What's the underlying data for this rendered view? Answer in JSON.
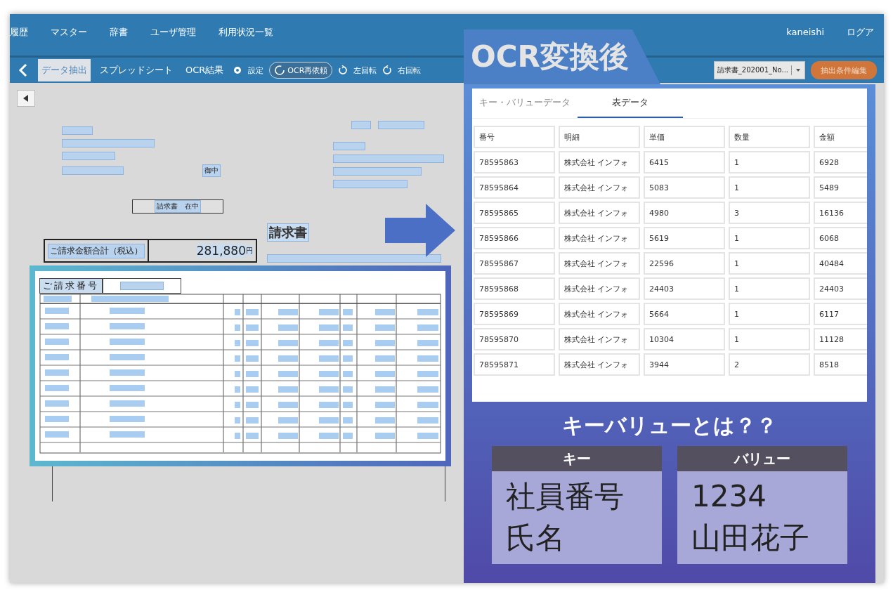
{
  "nav": {
    "items": [
      "履歴",
      "マスター",
      "辞書",
      "ユーザ管理",
      "利用状況一覧"
    ],
    "user": "kaneishi",
    "logout": "ログア"
  },
  "toolbar": {
    "tabs": [
      {
        "label": "データ抽出",
        "selected": true
      },
      {
        "label": "スプレッドシート",
        "selected": false
      },
      {
        "label": "OCR結果",
        "selected": false
      }
    ],
    "settings": "設定",
    "rerun": "OCR再依頼",
    "rotate_left": "左回転",
    "rotate_right": "右回転",
    "document_select": "請求書_202001_No...",
    "edit_button": "抽出条件編集"
  },
  "document": {
    "envelope_note": "請求書　在中",
    "addressee_suffix": "御中",
    "title": "請求書",
    "total_label": "ご請求金額合計（税込）",
    "total_amount": "281,880",
    "total_unit": "円",
    "invoice_number_label": "ご請求番号"
  },
  "ocr_panel": {
    "title": "OCR変換後",
    "tabs": [
      {
        "label": "キー・バリューデータ",
        "selected": false
      },
      {
        "label": "表データ",
        "selected": true
      }
    ],
    "columns": [
      "番号",
      "明細",
      "単価",
      "数量",
      "金額"
    ],
    "rows": [
      [
        "78595863",
        "株式会社 インフォ",
        "6415",
        "1",
        "6928"
      ],
      [
        "78595864",
        "株式会社 インフォ",
        "5083",
        "1",
        "5489"
      ],
      [
        "78595865",
        "株式会社 インフォ",
        "4980",
        "3",
        "16136"
      ],
      [
        "78595866",
        "株式会社 インフォ",
        "5619",
        "1",
        "6068"
      ],
      [
        "78595867",
        "株式会社 インフォ",
        "22596",
        "1",
        "40484"
      ],
      [
        "78595868",
        "株式会社 インフォ",
        "24403",
        "1",
        "24403"
      ],
      [
        "78595869",
        "株式会社 インフォ",
        "5664",
        "1",
        "6117"
      ],
      [
        "78595870",
        "株式会社 インフォ",
        "10304",
        "1",
        "11128"
      ],
      [
        "78595871",
        "株式会社 インフォ",
        "3944",
        "2",
        "8518"
      ]
    ]
  },
  "explainer": {
    "heading": "キーバリューとは？？",
    "boxes": [
      {
        "header": "キー",
        "lines": [
          "社員番号",
          "氏名"
        ]
      },
      {
        "header": "バリュー",
        "lines": [
          "1234",
          "山田花子"
        ]
      }
    ]
  }
}
